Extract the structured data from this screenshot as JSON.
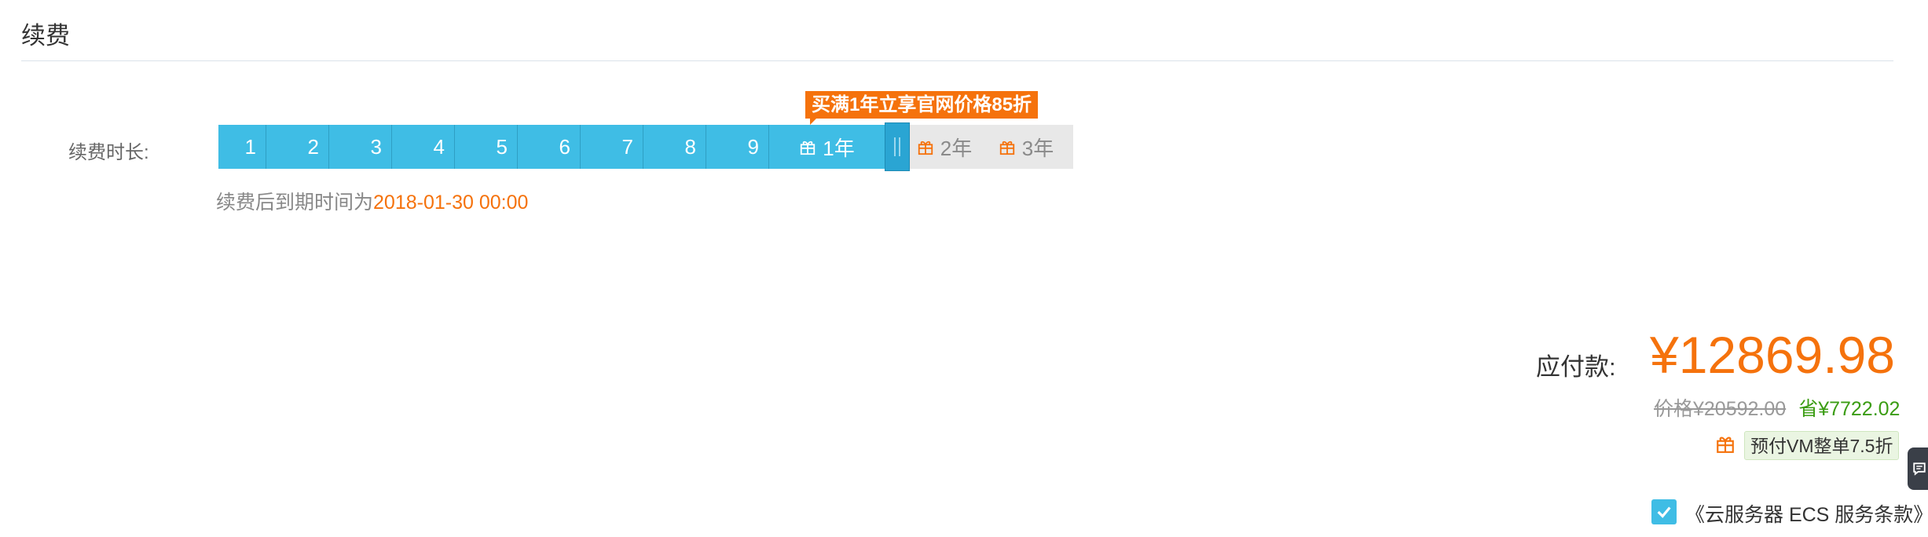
{
  "page": {
    "title": "续费"
  },
  "duration": {
    "label": "续费时长:",
    "months": [
      "1",
      "2",
      "3",
      "4",
      "5",
      "6",
      "7",
      "8",
      "9"
    ],
    "years": [
      "1年",
      "2年",
      "3年"
    ],
    "selected": "1年",
    "promo": "买满1年立享官网价格85折",
    "expiry_prefix": "续费后到期时间为",
    "expiry_date": "2018-01-30 00:00"
  },
  "payment": {
    "label": "应付款:",
    "amount": "¥12869.98",
    "original": "价格¥20592.00",
    "saved": "省¥7722.02",
    "discount_badge": "预付VM整单7.5折"
  },
  "terms": {
    "text": "《云服务器 ECS 服务条款》",
    "checked": true
  },
  "icons": {
    "gift": "gift-icon",
    "check": "check-icon",
    "grip": "grip-icon",
    "feedback": "feedback-icon"
  },
  "colors": {
    "accent": "#3fbde5",
    "orange": "#f5720c",
    "green": "#3a9c12",
    "inactive": "#e8e8e8"
  }
}
